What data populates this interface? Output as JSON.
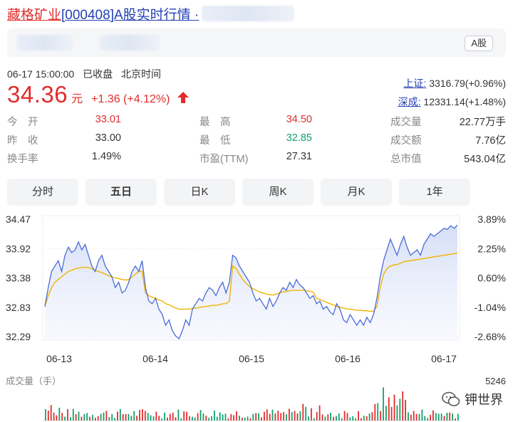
{
  "header": {
    "stock_name": "藏格矿业",
    "title_rest": "[000408]A股实时行情 ·"
  },
  "topbar": {
    "market_badge": "A股"
  },
  "status": {
    "datetime": "06-17 15:00:00",
    "state": "已收盘",
    "timezone": "北京时间"
  },
  "quote": {
    "price": "34.36",
    "unit": "元",
    "change": "+1.36 (+4.12%)"
  },
  "indices": [
    {
      "name": "上证:",
      "value": "3316.79(+0.96%)"
    },
    {
      "name": "深成:",
      "value": "12331.14(+1.48%)"
    }
  ],
  "stats": {
    "rows": [
      [
        {
          "label": "今　开",
          "value": "33.01",
          "color": "red"
        },
        {
          "label": "最　高",
          "value": "34.50",
          "color": "red"
        },
        {
          "label": "成交量",
          "value": "22.77万手",
          "color": "plain"
        }
      ],
      [
        {
          "label": "昨　收",
          "value": "33.00",
          "color": "plain"
        },
        {
          "label": "最　低",
          "value": "32.85",
          "color": "green"
        },
        {
          "label": "成交额",
          "value": "7.76亿",
          "color": "plain"
        }
      ],
      [
        {
          "label": "换手率",
          "value": "1.49%",
          "color": "plain"
        },
        {
          "label": "市盈(TTM)",
          "value": "27.31",
          "color": "plain"
        },
        {
          "label": "总市值",
          "value": "543.04亿",
          "color": "plain"
        }
      ]
    ]
  },
  "tabs": [
    {
      "label": "分时",
      "active": false
    },
    {
      "label": "五日",
      "active": true
    },
    {
      "label": "日K",
      "active": false
    },
    {
      "label": "周K",
      "active": false
    },
    {
      "label": "月K",
      "active": false
    },
    {
      "label": "1年",
      "active": false
    }
  ],
  "chart_data": {
    "type": "line",
    "y_ticks": [
      "34.47",
      "33.92",
      "33.38",
      "32.83",
      "32.29"
    ],
    "y_pct_ticks": [
      "3.89%",
      "2.25%",
      "0.60%",
      "-1.04%",
      "-2.68%"
    ],
    "x_ticks": [
      "06-13",
      "06-14",
      "06-15",
      "06-16",
      "06-17"
    ],
    "ylim": [
      32.29,
      34.47
    ],
    "volume_label": "成交量（手）",
    "volume_max": "5246",
    "series": [
      {
        "values": [
          32.85,
          33.2,
          33.5,
          33.6,
          33.7,
          33.5,
          33.8,
          33.95,
          33.85,
          33.9,
          34.05,
          33.9,
          34.0,
          33.8,
          33.6,
          33.5,
          33.7,
          33.8,
          33.6,
          33.5,
          33.4,
          33.2,
          33.3,
          33.1,
          33.15,
          33.3,
          33.5,
          33.6,
          33.5,
          33.7,
          33.2,
          32.95,
          32.9,
          33.0,
          32.8,
          32.7,
          32.5,
          32.6,
          32.4,
          32.3,
          32.25,
          32.4,
          32.6,
          32.5,
          32.8,
          32.9,
          33.0,
          32.95,
          33.1,
          33.2,
          33.15,
          33.05,
          33.2,
          33.3,
          33.1,
          33.3,
          33.8,
          33.75,
          33.6,
          33.5,
          33.4,
          33.3,
          33.1,
          32.95,
          33.0,
          32.9,
          32.8,
          33.0,
          32.85,
          32.95,
          33.1,
          33.2,
          33.15,
          33.3,
          33.2,
          33.35,
          33.25,
          33.2,
          33.1,
          33.0,
          33.05,
          32.9,
          32.95,
          32.8,
          32.85,
          32.75,
          32.7,
          32.9,
          32.8,
          32.6,
          32.55,
          32.7,
          32.6,
          32.5,
          32.6,
          32.5,
          32.65,
          32.55,
          32.7,
          33.0,
          33.4,
          33.7,
          33.9,
          34.1,
          33.95,
          33.8,
          34.0,
          34.15,
          33.95,
          33.8,
          33.85,
          33.9,
          33.8,
          34.0,
          34.1,
          34.2,
          34.15,
          34.2,
          34.25,
          34.3,
          34.28,
          34.35,
          34.3,
          34.36
        ]
      },
      {
        "values": [
          32.85,
          33.05,
          33.2,
          33.3,
          33.35,
          33.4,
          33.45,
          33.5,
          33.52,
          33.55,
          33.56,
          33.57,
          33.58,
          33.57,
          33.55,
          33.52,
          33.5,
          33.48,
          33.45,
          33.42,
          33.4,
          33.38,
          33.37,
          33.35,
          33.34,
          33.35,
          33.4,
          33.45,
          33.5,
          33.5,
          33.1,
          33.05,
          33.02,
          33.0,
          32.97,
          32.95,
          32.9,
          32.88,
          32.85,
          32.82,
          32.8,
          32.8,
          32.8,
          32.8,
          32.81,
          32.82,
          32.83,
          32.84,
          32.85,
          32.86,
          32.87,
          32.87,
          32.88,
          32.9,
          32.9,
          32.95,
          33.6,
          33.55,
          33.45,
          33.35,
          33.28,
          33.22,
          33.18,
          33.15,
          33.12,
          33.1,
          33.08,
          33.07,
          33.06,
          33.08,
          33.1,
          33.12,
          33.13,
          33.14,
          33.15,
          33.15,
          33.15,
          33.15,
          33.14,
          33.13,
          33.12,
          33.0,
          32.98,
          32.95,
          32.93,
          32.9,
          32.88,
          32.85,
          32.84,
          32.82,
          32.8,
          32.8,
          32.79,
          32.78,
          32.78,
          32.77,
          32.77,
          32.76,
          32.76,
          32.85,
          33.2,
          33.45,
          33.55,
          33.6,
          33.62,
          33.63,
          33.65,
          33.68,
          33.69,
          33.7,
          33.71,
          33.72,
          33.73,
          33.74,
          33.75,
          33.76,
          33.77,
          33.78,
          33.79,
          33.8,
          33.81,
          33.82,
          33.83,
          33.84
        ]
      }
    ]
  },
  "watermark": {
    "text": "钾世界"
  },
  "colors": {
    "up": "#e02d2d",
    "down": "#14a06c",
    "link": "#2440b3",
    "price_line": "#4a6bd6",
    "avg_line": "#f0b400"
  }
}
